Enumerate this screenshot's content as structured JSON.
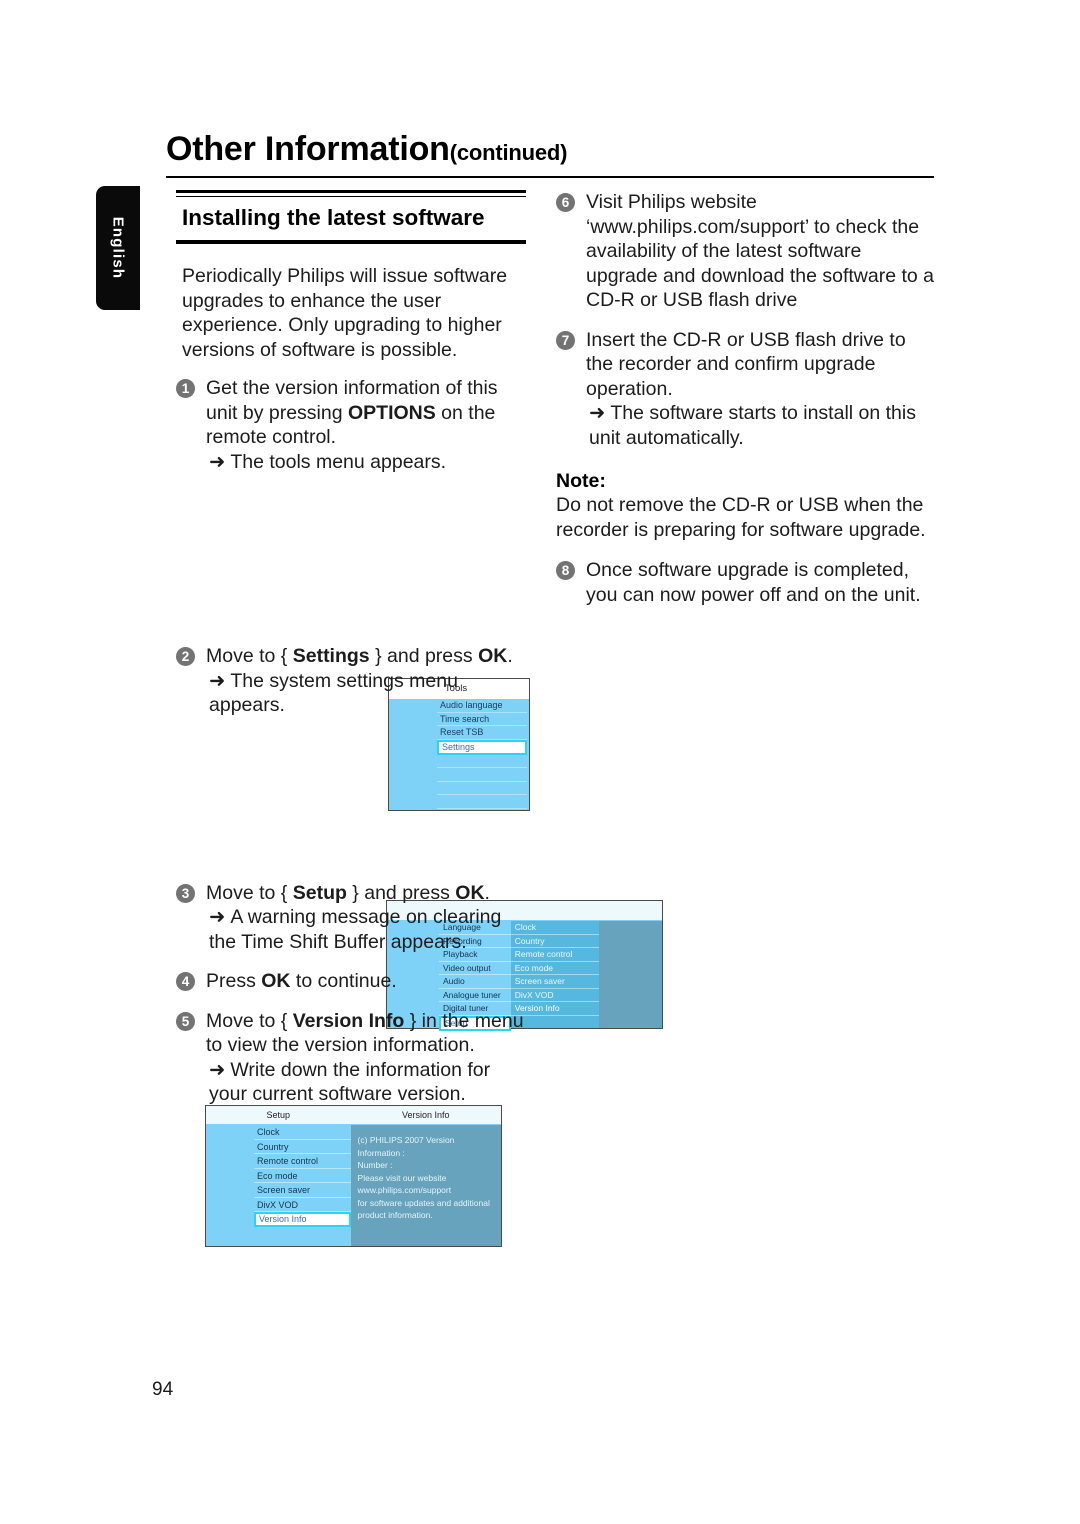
{
  "page": {
    "title_main": "Other Information",
    "title_continued": "(continued)",
    "number": "94",
    "language_tab": "English"
  },
  "section": {
    "heading": "Installing the latest software",
    "intro": "Periodically Philips will issue software upgrades to enhance the user experience. Only upgrading to higher versions of software is possible."
  },
  "steps_left": [
    {
      "num": "1",
      "text_a": "Get the version information of this unit by pressing ",
      "bold_a": "OPTIONS",
      "text_b": " on the remote control.",
      "sub": "The tools menu appears.",
      "arrow": "➜"
    },
    {
      "num": "2",
      "text_a": "Move to { ",
      "bold_a": "Settings",
      "text_b": " } and press ",
      "bold_b": "OK",
      "text_c": ".",
      "sub": "The system settings menu appears.",
      "arrow": "➜"
    },
    {
      "num": "3",
      "text_a": "Move to { ",
      "bold_a": "Setup",
      "text_b": " } and press ",
      "bold_b": "OK",
      "text_c": ".",
      "sub": "A warning message on clearing the Time Shift Buffer appears.",
      "arrow": "➜"
    },
    {
      "num": "4",
      "text_a": "Press ",
      "bold_a": "OK",
      "text_b": " to continue."
    },
    {
      "num": "5",
      "text_a": "Move to { ",
      "bold_a": "Version Info",
      "text_b": " } in the menu to view the version information.",
      "sub": "Write down the information for your current software version.",
      "arrow": "➜"
    }
  ],
  "steps_right": [
    {
      "num": "6",
      "text_a": "Visit Philips website ‘www.philips.com/support’ to check the availability of the latest software upgrade and download the software to a CD-R or USB flash drive"
    },
    {
      "num": "7",
      "text_a": "Insert the CD-R or USB flash drive to the recorder and confirm upgrade operation.",
      "sub": "The software starts to install on this unit automatically.",
      "arrow": "➜"
    },
    {
      "num": "8",
      "text_a": "Once software upgrade is completed, you can now power off and on the unit."
    }
  ],
  "note": {
    "title": "Note:",
    "body": "Do not remove the CD-R or USB when the recorder is preparing for software upgrade."
  },
  "screenshots": {
    "tools": {
      "header": "Tools",
      "items": [
        "Audio language",
        "Time search",
        "Reset TSB"
      ],
      "selected": "Settings",
      "empty_rows": 4
    },
    "settings": {
      "header": "",
      "left_items": [
        "Language",
        "Recording",
        "Playback",
        "Video output",
        "Audio",
        "Analogue tuner",
        "Digital tuner"
      ],
      "left_selected": "Setup",
      "right_items": [
        "Clock",
        "Country",
        "Remote control",
        "Eco mode",
        "Screen saver",
        "DivX VOD"
      ],
      "right_strong": "Version Info"
    },
    "version": {
      "header_left": "Setup",
      "header_right": "Version Info",
      "items": [
        "Clock",
        "Country",
        "Remote control",
        "Eco mode",
        "Screen saver",
        "DivX VOD"
      ],
      "selected": "Version Info",
      "info_lines": [
        "(c) PHILIPS 2007 Version",
        "Information :",
        "Number :",
        "Please visit our website",
        "www.philips.com/support",
        "for software updates and additional",
        "product information."
      ]
    }
  },
  "colors": {
    "panel_light_blue": "#7fd2f7",
    "panel_mid_blue": "#56b8df",
    "panel_gray_blue": "#67a3bc",
    "highlight_cyan": "#25d6f5",
    "step_badge_gray": "#737373"
  }
}
